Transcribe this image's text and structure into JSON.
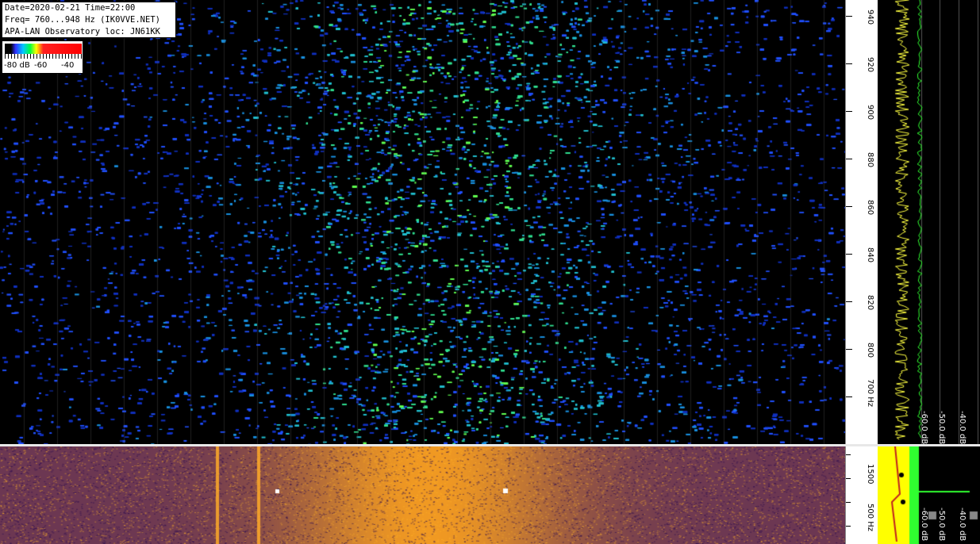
{
  "header": {
    "line1": "Date=2020-02-21 Time=22:00",
    "line2": "Freq= 760...948 Hz (IK0VVE.NET)",
    "line3": "APA-LAN Observatory loc: JN61KK"
  },
  "colorscale": {
    "label_a": "-80 dB",
    "label_b": "-60",
    "label_c": "-40"
  },
  "top_axis": {
    "labels": [
      "940",
      "920",
      "900",
      "880",
      "860",
      "840",
      "820",
      "800",
      "700 Hz"
    ]
  },
  "bottom_axis": {
    "labels": [
      "1500",
      "500 Hz"
    ]
  },
  "top_spectrum": {
    "db_labels": [
      "-60.0 dB",
      "-50.0 dB",
      "-40.0 dB"
    ]
  },
  "bottom_spectrum": {
    "db_labels": [
      "-60.0 dB",
      "-50.0 dB",
      "-40.0 dB"
    ]
  },
  "colors": {
    "trace_yellow": "#ffff40",
    "trace_green": "#30ff30",
    "waterfall_low": "#000000",
    "waterfall_mid": "#2040ff",
    "waterfall_high": "#40ff60",
    "bottom_low": "#2a1060",
    "bottom_high": "#ffb020",
    "time_label": "#e02020"
  }
}
